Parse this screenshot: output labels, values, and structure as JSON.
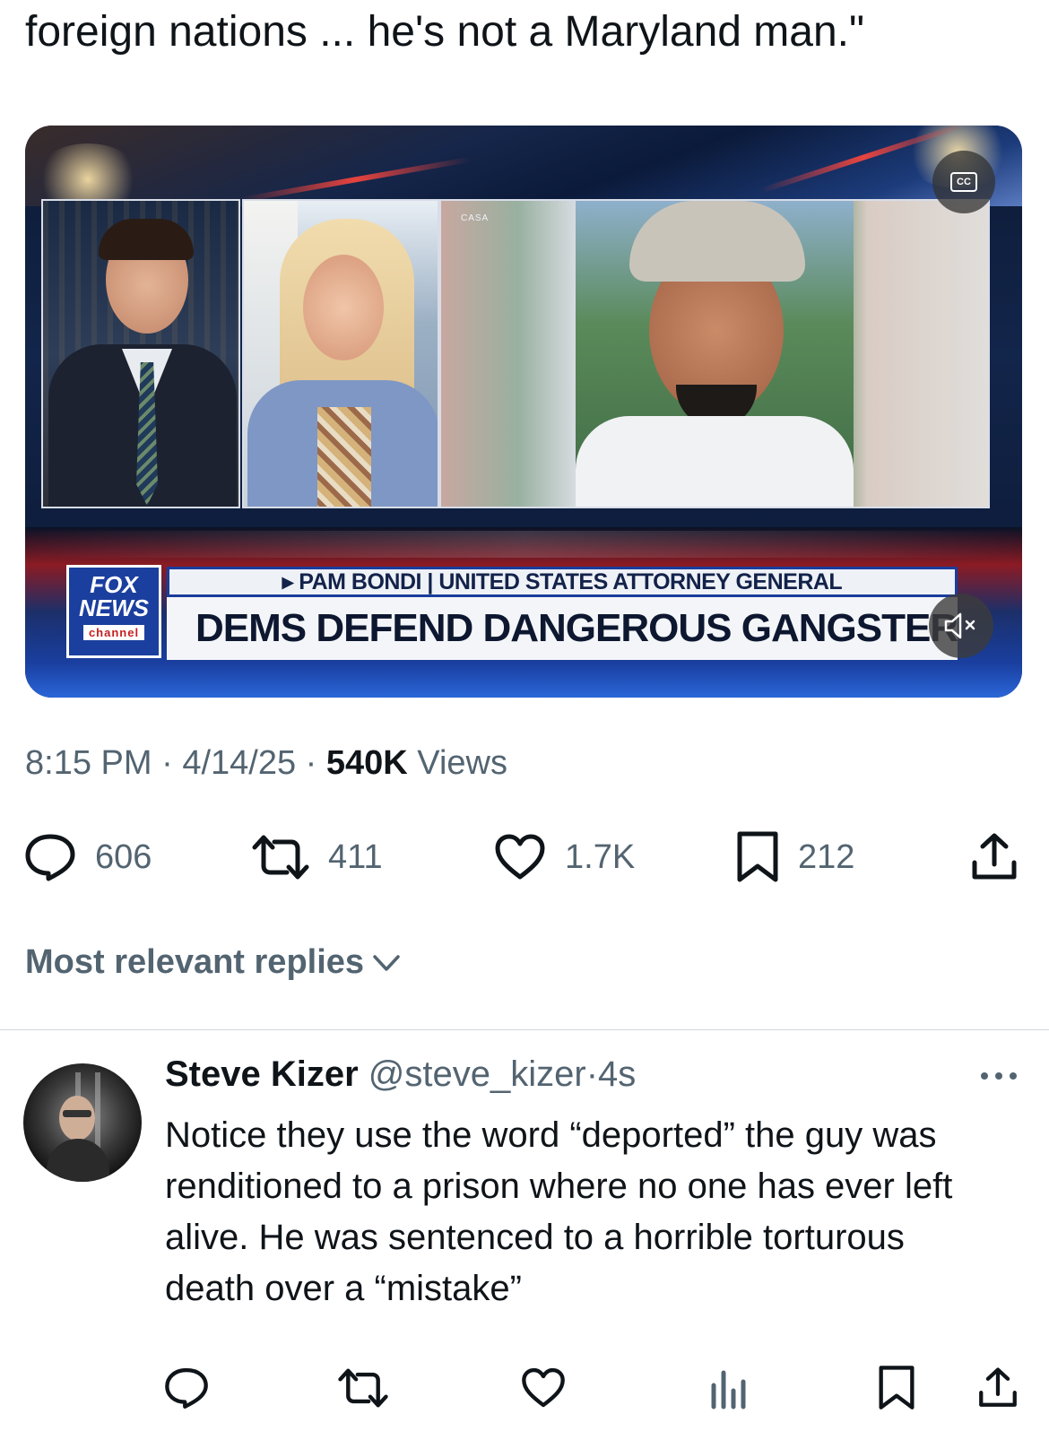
{
  "tweet": {
    "text_tail": "foreign nations ... he's not a Maryland man.\""
  },
  "media": {
    "panel_label": "CASA",
    "cc_label": "CC",
    "chyron_top": "▸ PAM BONDI | UNITED STATES ATTORNEY GENERAL",
    "chyron_main": "DEMS DEFEND DANGEROUS GANGSTER",
    "logo_line1": "FOX",
    "logo_line2": "NEWS",
    "logo_line3": "channel"
  },
  "meta": {
    "time": "8:15 PM",
    "date": "4/14/25",
    "separator": "·",
    "views_count": "540K",
    "views_label": "Views"
  },
  "actions": {
    "replies": "606",
    "reposts": "411",
    "likes": "1.7K",
    "bookmarks": "212"
  },
  "replies_sort": {
    "label": "Most relevant replies"
  },
  "reply": {
    "name": "Steve Kizer",
    "handle": "@steve_kizer",
    "separator": "·",
    "time": "4s",
    "text": "Notice they use the word “deported” the guy was renditioned to a prison where no one has ever left alive. He was sentenced to a horrible torturous death over a “mistake”"
  },
  "colors": {
    "text_primary": "#0f1419",
    "text_secondary": "#536471",
    "divider": "#cfd9de"
  }
}
